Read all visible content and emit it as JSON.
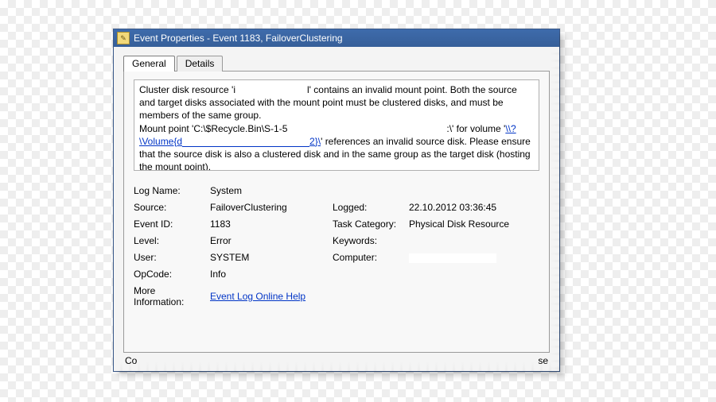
{
  "window": {
    "title": "Event Properties - Event 1183, FailoverClustering",
    "icon_name": "event-icon"
  },
  "tabs": {
    "general": "General",
    "details": "Details",
    "active": "General"
  },
  "description": {
    "part1": "Cluster disk resource 'i",
    "part2": "l' contains an invalid mount point. Both the source and target disks associated with the mount point must be clustered disks, and must be members of the same group.",
    "part3": "Mount point 'C:\\$Recycle.Bin\\S-1-5",
    "part4": ":\\' for volume '",
    "volume_link_prefix": "\\\\?\\Volume{d",
    "volume_link_suffix": "2}\\",
    "part5": "' references an invalid source disk. Please ensure that the source disk is also a clustered disk and in the same group as the target disk (hosting the mount point)."
  },
  "fields": {
    "labels": {
      "log_name": "Log Name:",
      "source": "Source:",
      "event_id": "Event ID:",
      "level": "Level:",
      "user": "User:",
      "opcode": "OpCode:",
      "more_info": "More Information:",
      "logged": "Logged:",
      "task_category": "Task Category:",
      "keywords": "Keywords:",
      "computer": "Computer:"
    },
    "values": {
      "log_name": "System",
      "source": "FailoverClustering",
      "event_id": "1183",
      "level": "Error",
      "user": "SYSTEM",
      "opcode": "Info",
      "logged": "22.10.2012 03:36:45",
      "task_category": "Physical Disk Resource",
      "keywords": "",
      "computer": "",
      "more_info_link": "Event Log Online Help"
    }
  },
  "fragments": {
    "left_btn": "Co",
    "right_btn": "se"
  }
}
